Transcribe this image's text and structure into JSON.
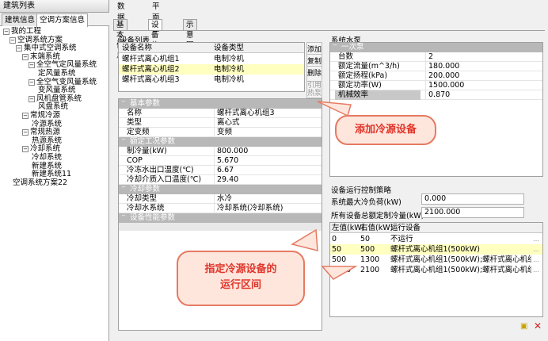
{
  "left_panel": {
    "title": "建筑列表",
    "tabs": [
      "建筑信息",
      "空调方案信息"
    ],
    "tree": [
      {
        "label": "我的工程",
        "level": 0,
        "exp": "−"
      },
      {
        "label": "空调系统方案",
        "level": 1,
        "exp": "−"
      },
      {
        "label": "集中式空调系统",
        "level": 2,
        "exp": "−"
      },
      {
        "label": "末端系统",
        "level": 3,
        "exp": "−"
      },
      {
        "label": "全空气定风量系统",
        "level": 4,
        "exp": "−"
      },
      {
        "label": "定风量系统",
        "level": 5,
        "exp": ""
      },
      {
        "label": "全空气变风量系统",
        "level": 4,
        "exp": "−"
      },
      {
        "label": "变风量系统",
        "level": 5,
        "exp": ""
      },
      {
        "label": "风机盘管系统",
        "level": 4,
        "exp": "−"
      },
      {
        "label": "风盘系统",
        "level": 5,
        "exp": ""
      },
      {
        "label": "常规冷源",
        "level": 3,
        "exp": "−"
      },
      {
        "label": "冷源系统",
        "level": 4,
        "exp": ""
      },
      {
        "label": "常规热源",
        "level": 3,
        "exp": "−"
      },
      {
        "label": "热源系统",
        "level": 4,
        "exp": ""
      },
      {
        "label": "冷却系统",
        "level": 3,
        "exp": "−"
      },
      {
        "label": "冷却系统",
        "level": 4,
        "exp": ""
      },
      {
        "label": "新建系统",
        "level": 4,
        "exp": ""
      },
      {
        "label": "新建系统11",
        "level": 4,
        "exp": ""
      },
      {
        "label": "空调系统方案22",
        "level": 1,
        "exp": ""
      }
    ]
  },
  "main": {
    "top_tabs": [
      "数据中心",
      "平面图"
    ],
    "sub_tabs": [
      "基本信息",
      "设备信息",
      "示意图"
    ],
    "device_list": {
      "title": "设备列表",
      "headers": [
        "设备名称",
        "设备类型"
      ],
      "rows": [
        {
          "name": "螺杆式离心机组1",
          "type": "电制冷机"
        },
        {
          "name": "螺杆式离心机组2",
          "type": "电制冷机"
        },
        {
          "name": "螺杆式离心机组3",
          "type": "电制冷机"
        }
      ],
      "buttons": [
        "添加",
        "复制",
        "删除",
        "引用\n热泵"
      ]
    },
    "props": {
      "sections": [
        {
          "title": "基本参数",
          "rows": [
            [
              "名称",
              "螺杆式离心机组3"
            ],
            [
              "类型",
              "离心式"
            ],
            [
              "定变频",
              "变频"
            ]
          ]
        },
        {
          "title": "额定工况参数",
          "rows": [
            [
              "制冷量(kW)",
              "800.000"
            ],
            [
              "COP",
              "5.670"
            ],
            [
              "冷冻水出口温度(℃)",
              "6.67"
            ],
            [
              "冷却介质入口温度(℃)",
              "29.40"
            ]
          ]
        },
        {
          "title": "冷却参数",
          "rows": [
            [
              "冷却类型",
              "水冷"
            ],
            [
              "冷却水系统",
              "冷却系统(冷却系统)"
            ]
          ]
        },
        {
          "title": "设备性能参数",
          "rows": []
        }
      ]
    },
    "pump": {
      "title": "系统水泵",
      "section": "一次泵",
      "rows": [
        [
          "台数",
          "2"
        ],
        [
          "额定流量(m^3/h)",
          "180.000"
        ],
        [
          "额定扬程(kPa)",
          "200.000"
        ],
        [
          "额定功率(W)",
          "1500.000"
        ],
        [
          "机械效率",
          "0.870"
        ]
      ]
    },
    "strategy": {
      "title": "设备运行控制策略",
      "max_load_label": "系统最大冷负荷(kW)",
      "max_load_value": "0.000",
      "total_label": "所有设备总额定制冷量(kW)",
      "total_value": "2100.000",
      "headers": [
        "左值(kW)",
        "右值(kW)",
        "运行设备"
      ],
      "rows": [
        {
          "l": "0",
          "r": "50",
          "dev": "不运行"
        },
        {
          "l": "50",
          "r": "500",
          "dev": "螺杆式离心机组1(500kW)"
        },
        {
          "l": "500",
          "r": "1300",
          "dev": "螺杆式离心机组1(500kW);螺杆式离心机组2..."
        },
        {
          "l": "1300",
          "r": "2100",
          "dev": "螺杆式离心机组1(500kW);螺杆式离心机组2..."
        }
      ]
    },
    "callout1": "添加冷源设备",
    "callout2": "指定冷源设备的\n运行区间"
  },
  "colors": {
    "selected_row": "#ffffc0",
    "callout_border": "#e57a62",
    "callout_text": "#e0352a",
    "callout_fill": "#ffe6dd"
  }
}
